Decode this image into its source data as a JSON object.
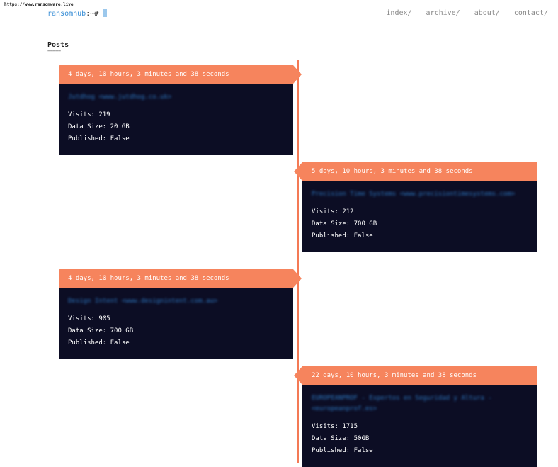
{
  "browser": {
    "url": "https://www.ransomware.live"
  },
  "site": {
    "host": "ransomhub",
    "prompt": ":~#"
  },
  "nav": {
    "index": "index/",
    "archive": "archive/",
    "about": "about/",
    "contact": "contact/"
  },
  "section": {
    "title": "Posts",
    "underline": "====="
  },
  "posts": [
    {
      "time": "4 days, 10 hours, 3 minutes and 38 seconds",
      "title": "Jutdhog <www.jutdhog.co.uk>",
      "visits": "Visits: 219",
      "size": "Data Size: 20 GB",
      "published": "Published: False"
    },
    {
      "time": "5 days, 10 hours, 3 minutes and 38 seconds",
      "title": "Precision Time Systems <www.precisiontimesystems.com>",
      "visits": "Visits: 212",
      "size": "Data Size: 700 GB",
      "published": "Published: False"
    },
    {
      "time": "4 days, 10 hours, 3 minutes and 38 seconds",
      "title": "Design Intent <www.designintent.com.au>",
      "visits": "Visits: 905",
      "size": "Data Size: 700 GB",
      "published": "Published: False"
    },
    {
      "time": "22 days, 10 hours, 3 minutes and 38 seconds",
      "title": "EUROPEANPROF - Expertos en Seguridad y Altura - <europeanprof.es>",
      "visits": "Visits: 1715",
      "size": "Data Size: 50GB",
      "published": "Published: False"
    }
  ]
}
